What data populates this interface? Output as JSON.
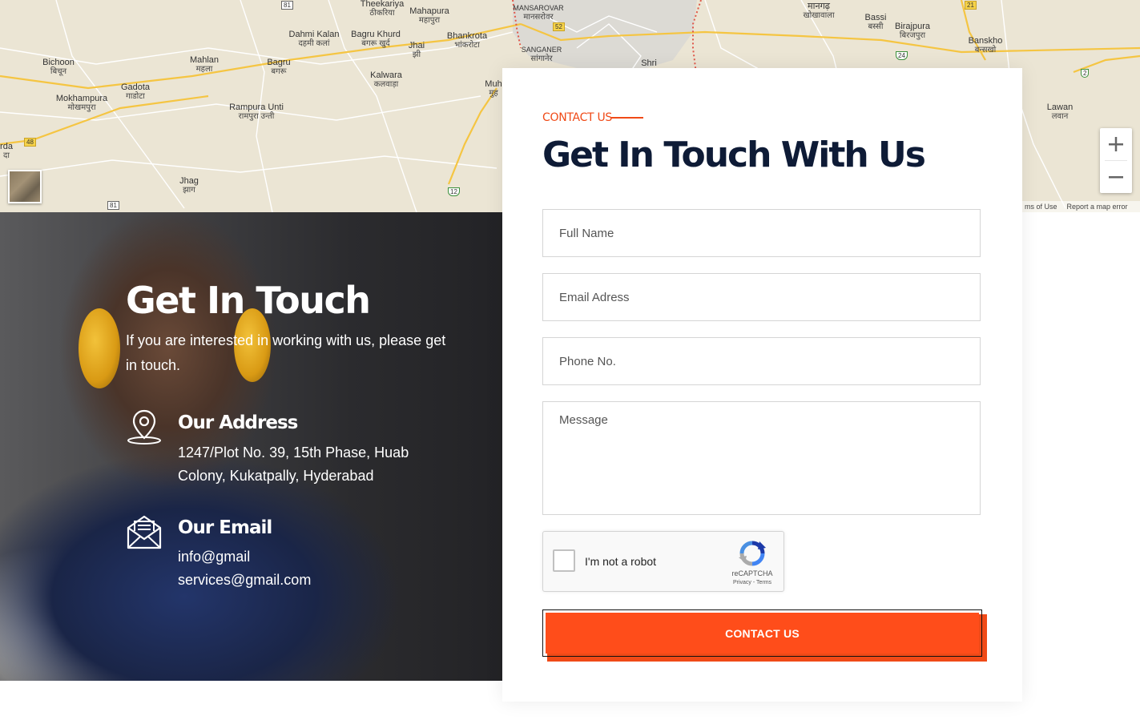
{
  "map": {
    "places": [
      {
        "en": "Theekariya",
        "hi": "ठीकरिया"
      },
      {
        "en": "Mahapura",
        "hi": "महापुरा"
      },
      {
        "en": "MANSAROVAR",
        "hi": "मानसरोवर"
      },
      {
        "en": "Dahmi Kalan",
        "hi": "दहमी कलां"
      },
      {
        "en": "Bagru Khurd",
        "hi": "बगरू खुर्द"
      },
      {
        "en": "Jhai",
        "hi": "झी"
      },
      {
        "en": "Bhankrota",
        "hi": "भांकरोटा"
      },
      {
        "en": "SANGANER",
        "hi": "सांगानेर"
      },
      {
        "en": "Shri",
        "hi": ""
      },
      {
        "en": "मानगढ़",
        "hi": "खोखावाला"
      },
      {
        "en": "Bassi",
        "hi": "बस्सी"
      },
      {
        "en": "Birajpura",
        "hi": "बिरजपुरा"
      },
      {
        "en": "Banskho",
        "hi": "बन्सखो"
      },
      {
        "en": "Bichoon",
        "hi": "बिचून"
      },
      {
        "en": "Mahlan",
        "hi": "महला"
      },
      {
        "en": "Bagru",
        "hi": "बगरू"
      },
      {
        "en": "Gadota",
        "hi": "गाडोटा"
      },
      {
        "en": "Mokhampura",
        "hi": "मोखमपुरा"
      },
      {
        "en": "Kalwara",
        "hi": "कलवाड़ा"
      },
      {
        "en": "Rampura Unti",
        "hi": "रामपुरा उन्ती"
      },
      {
        "en": "Muh",
        "hi": "मुह"
      },
      {
        "en": "Lawan",
        "hi": "लवान"
      },
      {
        "en": "rda",
        "hi": "दा"
      },
      {
        "en": "Jhag",
        "hi": "झाग"
      }
    ],
    "shields": [
      "81",
      "52",
      "21",
      "24",
      "2",
      "48",
      "12",
      "81"
    ],
    "zoom_in": "+",
    "zoom_out": "−",
    "footer": {
      "terms": "ms of Use",
      "report": "Report a map error"
    }
  },
  "hero": {
    "title": "Get In Touch",
    "text": "If you are interested in working with us, please get in touch.",
    "address": {
      "title": "Our Address",
      "line1": "1247/Plot No. 39, 15th Phase, Huab",
      "line2": "Colony, Kukatpally, Hyderabad",
      "icon": "map-pin-icon"
    },
    "email": {
      "title": "Our Email",
      "line1": "info@gmail",
      "line2": "services@gmail.com",
      "icon": "envelope-icon"
    }
  },
  "form": {
    "eyebrow": "CONTACT US",
    "title": "Get In Touch With Us",
    "fields": {
      "name": "Full Name",
      "email": "Email Adress",
      "phone": "Phone No.",
      "message": "Message"
    },
    "captcha": {
      "label": "I'm not a robot",
      "brand": "reCAPTCHA",
      "privacy": "Privacy",
      "separator": " - ",
      "terms": "Terms"
    },
    "submit": "CONTACT US"
  },
  "colors": {
    "accent": "#ff4d1a",
    "heading": "#0e1b36",
    "map_bg": "#ebe5d4"
  }
}
